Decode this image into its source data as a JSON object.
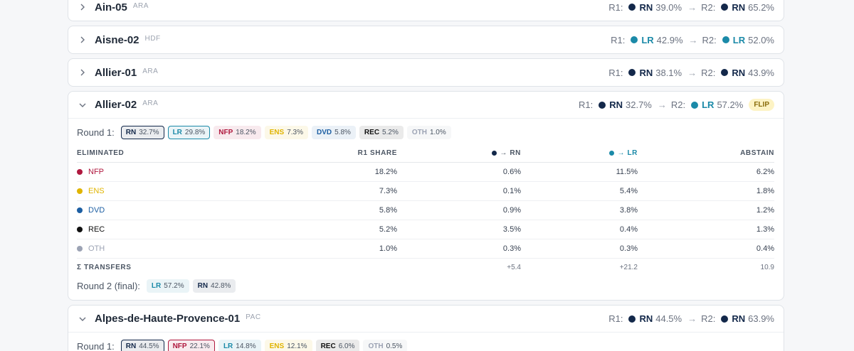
{
  "colors": {
    "RN": "#13284a",
    "LR": "#1b8aa8",
    "NFP": "#b0193f",
    "ENS": "#e0b400",
    "DVD": "#1d5fa3",
    "REC": "#111111",
    "OTH": "#9ca3b4"
  },
  "labels": {
    "r1": "R1:",
    "r2": "R2:",
    "arrow": "→"
  },
  "districts": [
    {
      "name": "Ain-05",
      "region": "ARA",
      "r1_party": "RN",
      "r1_pct": "39.0%",
      "r2_party": "RN",
      "r2_pct": "65.2%"
    },
    {
      "name": "Aisne-02",
      "region": "HDF",
      "r1_party": "LR",
      "r1_pct": "42.9%",
      "r2_party": "LR",
      "r2_pct": "52.0%"
    },
    {
      "name": "Allier-01",
      "region": "ARA",
      "r1_party": "RN",
      "r1_pct": "38.1%",
      "r2_party": "RN",
      "r2_pct": "43.9%"
    }
  ],
  "expanded": {
    "name": "Allier-02",
    "region": "ARA",
    "r1_party": "RN",
    "r1_pct": "32.7%",
    "r2_party": "LR",
    "r2_pct": "57.2%",
    "flip_label": "FLIP",
    "round1_label": "Round 1:",
    "round1": [
      {
        "party": "RN",
        "pct": "32.7%"
      },
      {
        "party": "LR",
        "pct": "29.8%"
      },
      {
        "party": "NFP",
        "pct": "18.2%"
      },
      {
        "party": "ENS",
        "pct": "7.3%"
      },
      {
        "party": "DVD",
        "pct": "5.8%"
      },
      {
        "party": "REC",
        "pct": "5.2%"
      },
      {
        "party": "OTH",
        "pct": "1.0%"
      }
    ],
    "table": {
      "headers": {
        "eliminated": "ELIMINATED",
        "share": "R1 SHARE",
        "to_rn": "→ RN",
        "to_lr": "→ LR",
        "abstain": "ABSTAIN"
      },
      "rows": [
        {
          "party": "NFP",
          "share": "18.2%",
          "rn": "0.6%",
          "lr": "11.5%",
          "abstain": "6.2%"
        },
        {
          "party": "ENS",
          "share": "7.3%",
          "rn": "0.1%",
          "lr": "5.4%",
          "abstain": "1.8%"
        },
        {
          "party": "DVD",
          "share": "5.8%",
          "rn": "0.9%",
          "lr": "3.8%",
          "abstain": "1.2%"
        },
        {
          "party": "REC",
          "share": "5.2%",
          "rn": "3.5%",
          "lr": "0.4%",
          "abstain": "1.3%"
        },
        {
          "party": "OTH",
          "share": "1.0%",
          "rn": "0.3%",
          "lr": "0.3%",
          "abstain": "0.4%"
        }
      ],
      "sum": {
        "label": "Σ TRANSFERS",
        "rn": "+5.4",
        "lr": "+21.2",
        "abstain": "10.9"
      }
    },
    "round2_label": "Round 2 (final):",
    "round2": [
      {
        "party": "LR",
        "pct": "57.2%"
      },
      {
        "party": "RN",
        "pct": "42.8%"
      }
    ]
  },
  "next": {
    "name": "Alpes-de-Haute-Provence-01",
    "region": "PAC",
    "r1_party": "RN",
    "r1_pct": "44.5%",
    "r2_party": "RN",
    "r2_pct": "63.9%",
    "round1_label": "Round 1:",
    "round1": [
      {
        "party": "RN",
        "pct": "44.5%"
      },
      {
        "party": "NFP",
        "pct": "22.1%"
      },
      {
        "party": "LR",
        "pct": "14.8%"
      },
      {
        "party": "ENS",
        "pct": "12.1%"
      },
      {
        "party": "REC",
        "pct": "6.0%"
      },
      {
        "party": "OTH",
        "pct": "0.5%"
      }
    ]
  }
}
